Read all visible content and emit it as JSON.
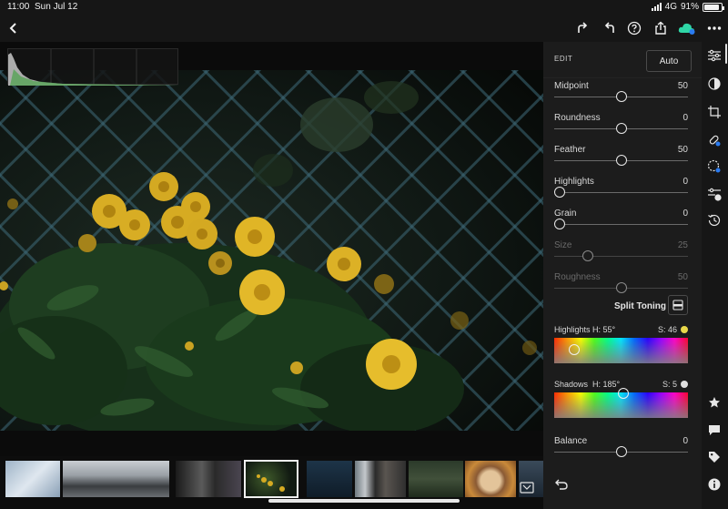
{
  "status_bar": {
    "time": "11:00",
    "date": "Sun Jul 12",
    "network": "4G",
    "battery": "91%",
    "battery_level": 0.91
  },
  "toolbar": {
    "back_icon": "chevron-left-icon",
    "redo_icon": "redo-icon",
    "undo_icon": "undo-icon",
    "help_icon": "help-icon",
    "share_icon": "share-icon",
    "cloud_icon": "cloud-sync-icon",
    "more_icon": "more-icon"
  },
  "edit_panel": {
    "title": "EDIT",
    "auto_label": "Auto",
    "sliders": [
      {
        "label": "Midpoint",
        "value": "50",
        "level": 0.5,
        "disabled": false
      },
      {
        "label": "Roundness",
        "value": "0",
        "level": 0.5,
        "disabled": false
      },
      {
        "label": "Feather",
        "value": "50",
        "level": 0.5,
        "disabled": false
      },
      {
        "label": "Highlights",
        "value": "0",
        "level": 0.0,
        "disabled": false
      },
      {
        "label": "Grain",
        "value": "0",
        "level": 0.0,
        "disabled": false
      },
      {
        "label": "Size",
        "value": "25",
        "level": 0.25,
        "disabled": true
      },
      {
        "label": "Roughness",
        "value": "50",
        "level": 0.5,
        "disabled": true
      }
    ],
    "split_toning": {
      "title": "Split Toning",
      "highlights": {
        "label": "Highlights",
        "hue": "H: 55°",
        "sat": "S: 46",
        "hue_value": 55,
        "sat_value": 46,
        "color": "#e8d84a"
      },
      "shadows": {
        "label": "Shadows",
        "hue": "H: 185°",
        "sat": "S: 5",
        "hue_value": 185,
        "sat_value": 5,
        "color": "#e0e0e0"
      },
      "balance": {
        "label": "Balance",
        "value": "0",
        "level": 0.5
      }
    }
  },
  "right_rail": [
    "sliders-icon",
    "color-icon",
    "crop-icon",
    "healing-icon",
    "selective-icon",
    "presets-icon",
    "history-icon",
    "star-icon",
    "comment-icon",
    "tag-icon",
    "info-icon"
  ],
  "filmstrip": {
    "count": 9,
    "selected_index": 4
  }
}
